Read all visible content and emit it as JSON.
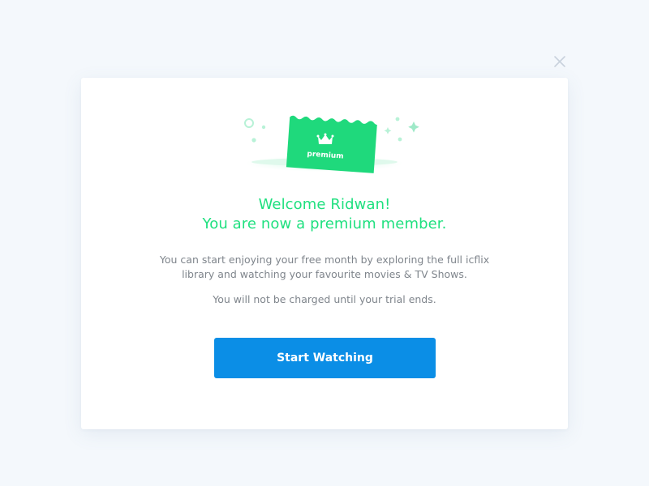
{
  "close_icon": "close-icon",
  "illustration": {
    "ticket_label": "premium",
    "icon": "crown-icon"
  },
  "heading": {
    "line1": "Welcome Ridwan!",
    "line2": "You are now a premium member."
  },
  "body": {
    "paragraph1_line1": "You can start enjoying your free month by exploring the full icflix",
    "paragraph1_line2": "library and watching your favourite movies & TV Shows.",
    "paragraph2": "You will not be charged until your trial ends."
  },
  "cta": {
    "label": "Start Watching"
  },
  "colors": {
    "background": "#f4f8fc",
    "accent_green": "#1fe07f",
    "button_blue": "#0b8ee6",
    "body_text": "#7f858c"
  }
}
